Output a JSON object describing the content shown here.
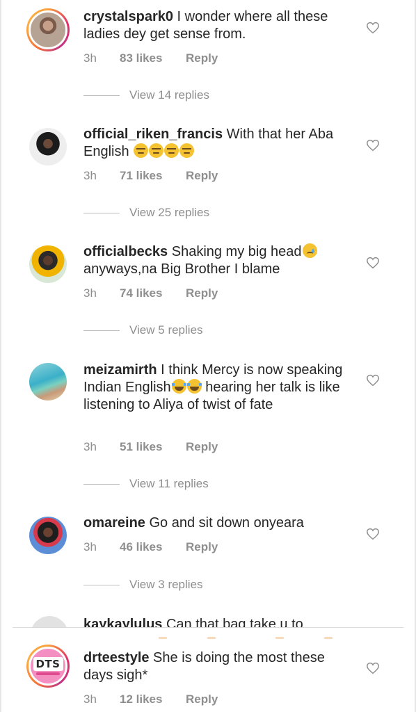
{
  "comments": [
    {
      "username": "crystalspark0",
      "text": " I wonder where all these ladies dey get sense from.",
      "time": "3h",
      "likes": "83 likes",
      "reply": "Reply",
      "view_replies": "View 14 replies"
    },
    {
      "username": "official_riken_francis",
      "text": " With that her Aba English ",
      "emojis": [
        "unamused",
        "unamused",
        "unamused",
        "unamused"
      ],
      "time": "3h",
      "likes": "71 likes",
      "reply": "Reply",
      "view_replies": "View 25 replies"
    },
    {
      "username": "officialbecks",
      "text": " Shaking my big head",
      "text_after": "anyways,na Big Brother I blame",
      "emojis": [
        "cry"
      ],
      "time": "3h",
      "likes": "74 likes",
      "reply": "Reply",
      "view_replies": "View 5 replies"
    },
    {
      "username": "meizamirth",
      "text": " I think Mercy is now speaking Indian English",
      "text_after": " hearing her talk is like listening to Aliya of twist of fate",
      "emojis": [
        "joy",
        "joy"
      ],
      "time": "3h",
      "likes": "51 likes",
      "reply": "Reply",
      "view_replies": "View 11 replies"
    },
    {
      "username": "omareine",
      "text": " Go and sit down onyeara",
      "time": "3h",
      "likes": "46 likes",
      "reply": "Reply",
      "view_replies": "View 3 replies"
    },
    {
      "username": "kaykaylulus",
      "text": " Can that bag take u to"
    },
    {
      "username": "drteestyle",
      "text": " She is doing the most these days sigh*",
      "time": "3h",
      "likes": "12 likes",
      "reply": "Reply",
      "avatar_logo": "DTS"
    }
  ],
  "icons": {
    "like": "heart-outline-icon"
  },
  "colors": {
    "text": "#262626",
    "muted": "#8e8e8e",
    "story_ring": "#e1306c"
  }
}
